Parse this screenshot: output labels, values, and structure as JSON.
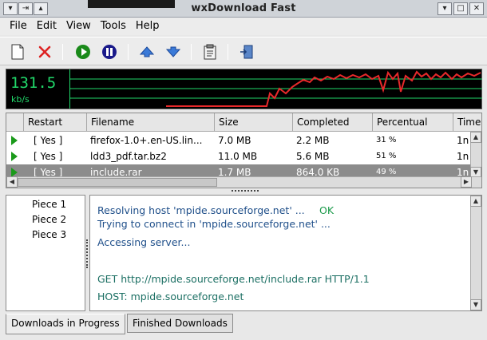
{
  "window": {
    "title": "wxDownload Fast",
    "left_buttons": [
      "▾",
      "⇥",
      "▴"
    ],
    "right_buttons": [
      "▾",
      "□",
      "✕"
    ]
  },
  "menu": [
    "File",
    "Edit",
    "View",
    "Tools",
    "Help"
  ],
  "toolbar": {
    "icons": [
      "new-icon",
      "delete-icon",
      "start-icon",
      "pause-icon",
      "move-up-icon",
      "move-down-icon",
      "properties-icon",
      "exit-icon"
    ]
  },
  "graph": {
    "speed": "131.5",
    "unit": "kb/s",
    "line_color": "#e8292b",
    "grid_color": "#21d86a"
  },
  "table": {
    "columns": [
      "Restart",
      "Filename",
      "Size",
      "Completed",
      "Percentual",
      "Time"
    ],
    "rows": [
      {
        "restart": "[ Yes ]",
        "filename": "firefox-1.0+.en-US.lin...",
        "size": "7.0 MB",
        "completed": "2.2 MB",
        "percent": "31 %",
        "time": "1n",
        "selected": false
      },
      {
        "restart": "[ Yes ]",
        "filename": "ldd3_pdf.tar.bz2",
        "size": "11.0 MB",
        "completed": "5.6 MB",
        "percent": "51 %",
        "time": "1n",
        "selected": false
      },
      {
        "restart": "[ Yes ]",
        "filename": "include.rar",
        "size": "1.7 MB",
        "completed": "864.0 KB",
        "percent": "49 %",
        "time": "1n",
        "selected": true
      }
    ]
  },
  "pieces": [
    "Piece 1",
    "Piece 2",
    "Piece 3"
  ],
  "log": {
    "resolving": "Resolving host 'mpide.sourceforge.net' ...",
    "ok": "OK",
    "trying": "Trying to connect in 'mpide.sourceforge.net' ...",
    "accessing": "Accessing server...",
    "get": "GET http://mpide.sourceforge.net/include.rar HTTP/1.1",
    "host": "HOST: mpide.sourceforge.net"
  },
  "tabs": [
    "Downloads in Progress",
    "Finished Downloads"
  ]
}
